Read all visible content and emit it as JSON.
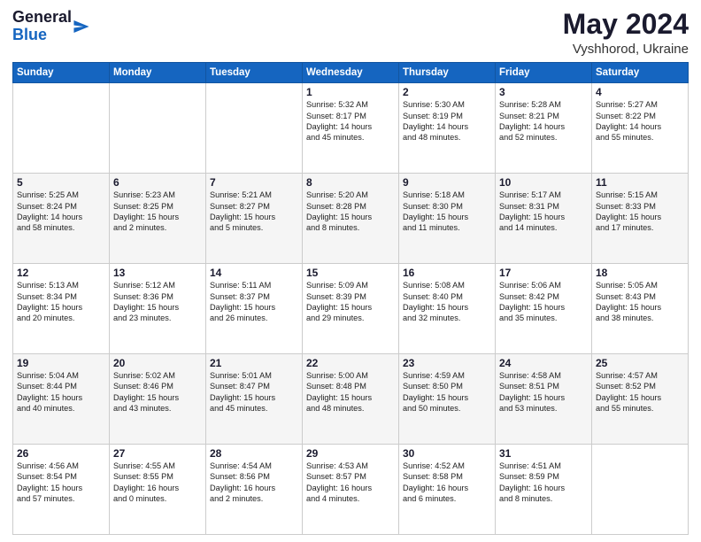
{
  "header": {
    "logo_line1": "General",
    "logo_line2": "Blue",
    "month": "May 2024",
    "location": "Vyshhorod, Ukraine"
  },
  "weekdays": [
    "Sunday",
    "Monday",
    "Tuesday",
    "Wednesday",
    "Thursday",
    "Friday",
    "Saturday"
  ],
  "weeks": [
    [
      {
        "day": "",
        "info": ""
      },
      {
        "day": "",
        "info": ""
      },
      {
        "day": "",
        "info": ""
      },
      {
        "day": "1",
        "info": "Sunrise: 5:32 AM\nSunset: 8:17 PM\nDaylight: 14 hours\nand 45 minutes."
      },
      {
        "day": "2",
        "info": "Sunrise: 5:30 AM\nSunset: 8:19 PM\nDaylight: 14 hours\nand 48 minutes."
      },
      {
        "day": "3",
        "info": "Sunrise: 5:28 AM\nSunset: 8:21 PM\nDaylight: 14 hours\nand 52 minutes."
      },
      {
        "day": "4",
        "info": "Sunrise: 5:27 AM\nSunset: 8:22 PM\nDaylight: 14 hours\nand 55 minutes."
      }
    ],
    [
      {
        "day": "5",
        "info": "Sunrise: 5:25 AM\nSunset: 8:24 PM\nDaylight: 14 hours\nand 58 minutes."
      },
      {
        "day": "6",
        "info": "Sunrise: 5:23 AM\nSunset: 8:25 PM\nDaylight: 15 hours\nand 2 minutes."
      },
      {
        "day": "7",
        "info": "Sunrise: 5:21 AM\nSunset: 8:27 PM\nDaylight: 15 hours\nand 5 minutes."
      },
      {
        "day": "8",
        "info": "Sunrise: 5:20 AM\nSunset: 8:28 PM\nDaylight: 15 hours\nand 8 minutes."
      },
      {
        "day": "9",
        "info": "Sunrise: 5:18 AM\nSunset: 8:30 PM\nDaylight: 15 hours\nand 11 minutes."
      },
      {
        "day": "10",
        "info": "Sunrise: 5:17 AM\nSunset: 8:31 PM\nDaylight: 15 hours\nand 14 minutes."
      },
      {
        "day": "11",
        "info": "Sunrise: 5:15 AM\nSunset: 8:33 PM\nDaylight: 15 hours\nand 17 minutes."
      }
    ],
    [
      {
        "day": "12",
        "info": "Sunrise: 5:13 AM\nSunset: 8:34 PM\nDaylight: 15 hours\nand 20 minutes."
      },
      {
        "day": "13",
        "info": "Sunrise: 5:12 AM\nSunset: 8:36 PM\nDaylight: 15 hours\nand 23 minutes."
      },
      {
        "day": "14",
        "info": "Sunrise: 5:11 AM\nSunset: 8:37 PM\nDaylight: 15 hours\nand 26 minutes."
      },
      {
        "day": "15",
        "info": "Sunrise: 5:09 AM\nSunset: 8:39 PM\nDaylight: 15 hours\nand 29 minutes."
      },
      {
        "day": "16",
        "info": "Sunrise: 5:08 AM\nSunset: 8:40 PM\nDaylight: 15 hours\nand 32 minutes."
      },
      {
        "day": "17",
        "info": "Sunrise: 5:06 AM\nSunset: 8:42 PM\nDaylight: 15 hours\nand 35 minutes."
      },
      {
        "day": "18",
        "info": "Sunrise: 5:05 AM\nSunset: 8:43 PM\nDaylight: 15 hours\nand 38 minutes."
      }
    ],
    [
      {
        "day": "19",
        "info": "Sunrise: 5:04 AM\nSunset: 8:44 PM\nDaylight: 15 hours\nand 40 minutes."
      },
      {
        "day": "20",
        "info": "Sunrise: 5:02 AM\nSunset: 8:46 PM\nDaylight: 15 hours\nand 43 minutes."
      },
      {
        "day": "21",
        "info": "Sunrise: 5:01 AM\nSunset: 8:47 PM\nDaylight: 15 hours\nand 45 minutes."
      },
      {
        "day": "22",
        "info": "Sunrise: 5:00 AM\nSunset: 8:48 PM\nDaylight: 15 hours\nand 48 minutes."
      },
      {
        "day": "23",
        "info": "Sunrise: 4:59 AM\nSunset: 8:50 PM\nDaylight: 15 hours\nand 50 minutes."
      },
      {
        "day": "24",
        "info": "Sunrise: 4:58 AM\nSunset: 8:51 PM\nDaylight: 15 hours\nand 53 minutes."
      },
      {
        "day": "25",
        "info": "Sunrise: 4:57 AM\nSunset: 8:52 PM\nDaylight: 15 hours\nand 55 minutes."
      }
    ],
    [
      {
        "day": "26",
        "info": "Sunrise: 4:56 AM\nSunset: 8:54 PM\nDaylight: 15 hours\nand 57 minutes."
      },
      {
        "day": "27",
        "info": "Sunrise: 4:55 AM\nSunset: 8:55 PM\nDaylight: 16 hours\nand 0 minutes."
      },
      {
        "day": "28",
        "info": "Sunrise: 4:54 AM\nSunset: 8:56 PM\nDaylight: 16 hours\nand 2 minutes."
      },
      {
        "day": "29",
        "info": "Sunrise: 4:53 AM\nSunset: 8:57 PM\nDaylight: 16 hours\nand 4 minutes."
      },
      {
        "day": "30",
        "info": "Sunrise: 4:52 AM\nSunset: 8:58 PM\nDaylight: 16 hours\nand 6 minutes."
      },
      {
        "day": "31",
        "info": "Sunrise: 4:51 AM\nSunset: 8:59 PM\nDaylight: 16 hours\nand 8 minutes."
      },
      {
        "day": "",
        "info": ""
      }
    ]
  ]
}
